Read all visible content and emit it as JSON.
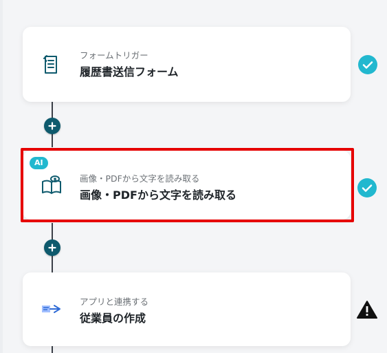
{
  "flow": {
    "steps": [
      {
        "subtitle": "フォームトリガー",
        "title": "履歴書送信フォーム",
        "status": "completed"
      },
      {
        "badge": "AI",
        "subtitle": "画像・PDFから文字を読み取る",
        "title": "画像・PDFから文字を読み取る",
        "status": "completed"
      },
      {
        "subtitle": "アプリと連携する",
        "title": "従業員の作成",
        "status": "warning"
      }
    ]
  },
  "icons": {
    "form": "form-document-icon",
    "ocr": "book-eye-icon",
    "app": "app-connector-icon",
    "check": "checkmark-icon",
    "warning": "warning-triangle-icon",
    "add": "plus-icon"
  },
  "colors": {
    "accent_check": "#22b8cf",
    "connector_plus": "#0e5a6d",
    "highlight": "#e60000",
    "ai_badge": "#22b8cf",
    "warning": "#111111"
  }
}
